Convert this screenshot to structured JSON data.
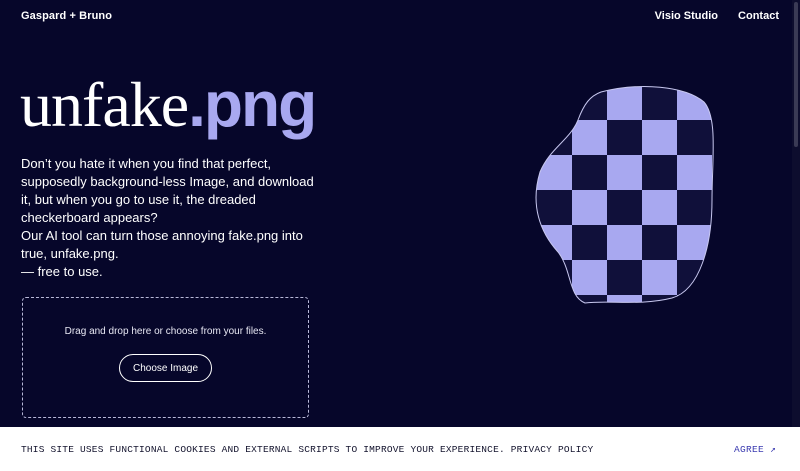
{
  "header": {
    "brand": "Gaspard + Bruno",
    "nav": [
      "Visio Studio",
      "Contact"
    ]
  },
  "hero": {
    "title_light": "unfake",
    "title_accent": ".png",
    "paragraph_1": "Don’t you hate it when you find that perfect, supposedly background-less Image, and download it, but when you go to use it, the dreaded checkerboard appears?",
    "paragraph_2": "Our AI tool can turn those annoying fake.png into true, unfake.png.",
    "paragraph_3": "— free to use."
  },
  "upload": {
    "instruction": "Drag and drop here or choose from your files.",
    "button_label": "Choose Image"
  },
  "cookie": {
    "message": "THIS SITE USES FUNCTIONAL COOKIES AND EXTERNAL SCRIPTS TO IMPROVE YOUR EXPERIENCE. PRIVACY POLICY",
    "agree_label": "AGREE",
    "agree_icon": "arrow-up-right-icon"
  },
  "colors": {
    "background": "#06062a",
    "accent": "#a8a8f0",
    "checker_dark": "#10103a",
    "cookie_bg": "#ffffff",
    "cookie_link": "#3a3ab0"
  }
}
